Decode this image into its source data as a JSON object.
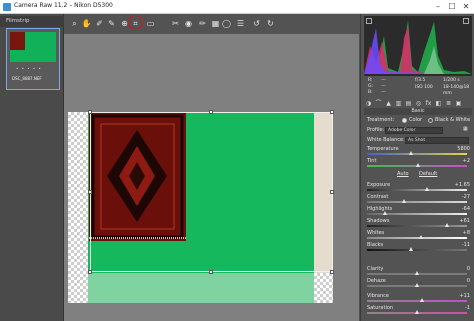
{
  "window": {
    "title": "Camera Raw 11.2  –  Nikon D5300",
    "min": "–",
    "max": "☐",
    "close": "✕"
  },
  "toolbar": {
    "tools": [
      "zoom-icon",
      "hand-icon",
      "white-balance-icon",
      "color-sampler-icon",
      "targeted-adjust-icon",
      "crop-icon",
      "straighten-icon",
      "spot-removal-icon",
      "red-eye-icon",
      "adjustment-brush-icon",
      "graduated-filter-icon",
      "radial-filter-icon",
      "preferences-icon",
      "rotate-left-icon",
      "rotate-right-icon"
    ],
    "selected_tool": "crop-icon"
  },
  "filmstrip": {
    "header": "Filmstrip",
    "thumb_name": "DSC_8887.NEF",
    "stars": "• • • • •"
  },
  "histogram": {
    "r_label": "R:",
    "g_label": "G:",
    "b_label": "B:",
    "r_val": "---",
    "g_val": "---",
    "b_val": "---",
    "aperture": "f/3.5",
    "shutter": "1/200 s",
    "iso": "ISO 100",
    "lens": "18-140@18 mm"
  },
  "panel": {
    "section": "Basic",
    "treatment_label": "Treatment:",
    "treatment_color": "Color",
    "treatment_bw": "Black & White",
    "profile_label": "Profile:",
    "profile_value": "Adobe Color",
    "wb_label": "White Balance:",
    "wb_value": "As Shot",
    "temperature_label": "Temperature",
    "temperature_value": "5800",
    "tint_label": "Tint",
    "tint_value": "+2",
    "auto_label": "Auto",
    "default_label": "Default",
    "exposure_label": "Exposure",
    "exposure_value": "+1.65",
    "contrast_label": "Contrast",
    "contrast_value": "-27",
    "highlights_label": "Highlights",
    "highlights_value": "-64",
    "shadows_label": "Shadows",
    "shadows_value": "+61",
    "whites_label": "Whites",
    "whites_value": "+8",
    "blacks_label": "Blacks",
    "blacks_value": "-11",
    "clarity_label": "Clarity",
    "clarity_value": "0",
    "dehaze_label": "Dehaze",
    "dehaze_value": "0",
    "vibrance_label": "Vibrance",
    "vibrance_value": "+11",
    "saturation_label": "Saturation",
    "saturation_value": "-1"
  },
  "colors": {
    "accent": "#d0181a",
    "green_screen": "#16b85e",
    "rug_red": "#6b0f0b"
  }
}
